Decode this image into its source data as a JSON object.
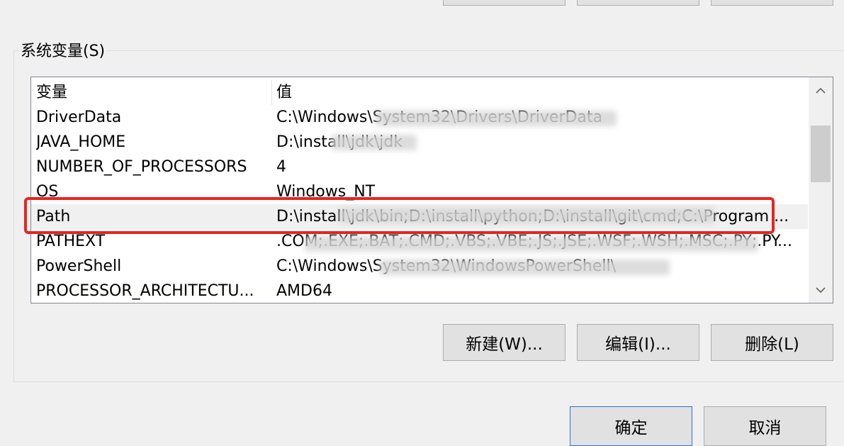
{
  "top_buttons": [
    "",
    "",
    ""
  ],
  "system_vars": {
    "title": "系统变量(S)",
    "columns": {
      "name": "变量",
      "value": "值"
    },
    "rows": [
      {
        "name": "DriverData",
        "value": "C:\\Windows\\System32\\Drivers\\DriverData"
      },
      {
        "name": "JAVA_HOME",
        "value": "D:\\install\\jdk\\jdk"
      },
      {
        "name": "NUMBER_OF_PROCESSORS",
        "value": "4"
      },
      {
        "name": "OS",
        "value": "Windows_NT"
      },
      {
        "name": "Path",
        "value": "D:\\install\\jdk\\bin;D:\\install\\python;D:\\install\\git\\cmd;C:\\Program ..."
      },
      {
        "name": "PATHEXT",
        "value": ".COM;.EXE;.BAT;.CMD;.VBS;.VBE;.JS;.JSE;.WSF;.WSH;.MSC;.PY;.PY..."
      },
      {
        "name": "PowerShell",
        "value": "C:\\Windows\\System32\\WindowsPowerShell\\"
      },
      {
        "name": "PROCESSOR_ARCHITECTU...",
        "value": "AMD64"
      }
    ],
    "buttons": {
      "new": "新建(W)...",
      "edit": "编辑(I)...",
      "delete": "删除(L)"
    }
  },
  "dialog_buttons": {
    "ok": "确定",
    "cancel": "取消"
  },
  "icons": {
    "scroll_up": "chevron-up-icon",
    "scroll_down": "chevron-down-icon"
  },
  "colors": {
    "highlight": "#e8241f",
    "ok_border": "#2a72d6"
  }
}
